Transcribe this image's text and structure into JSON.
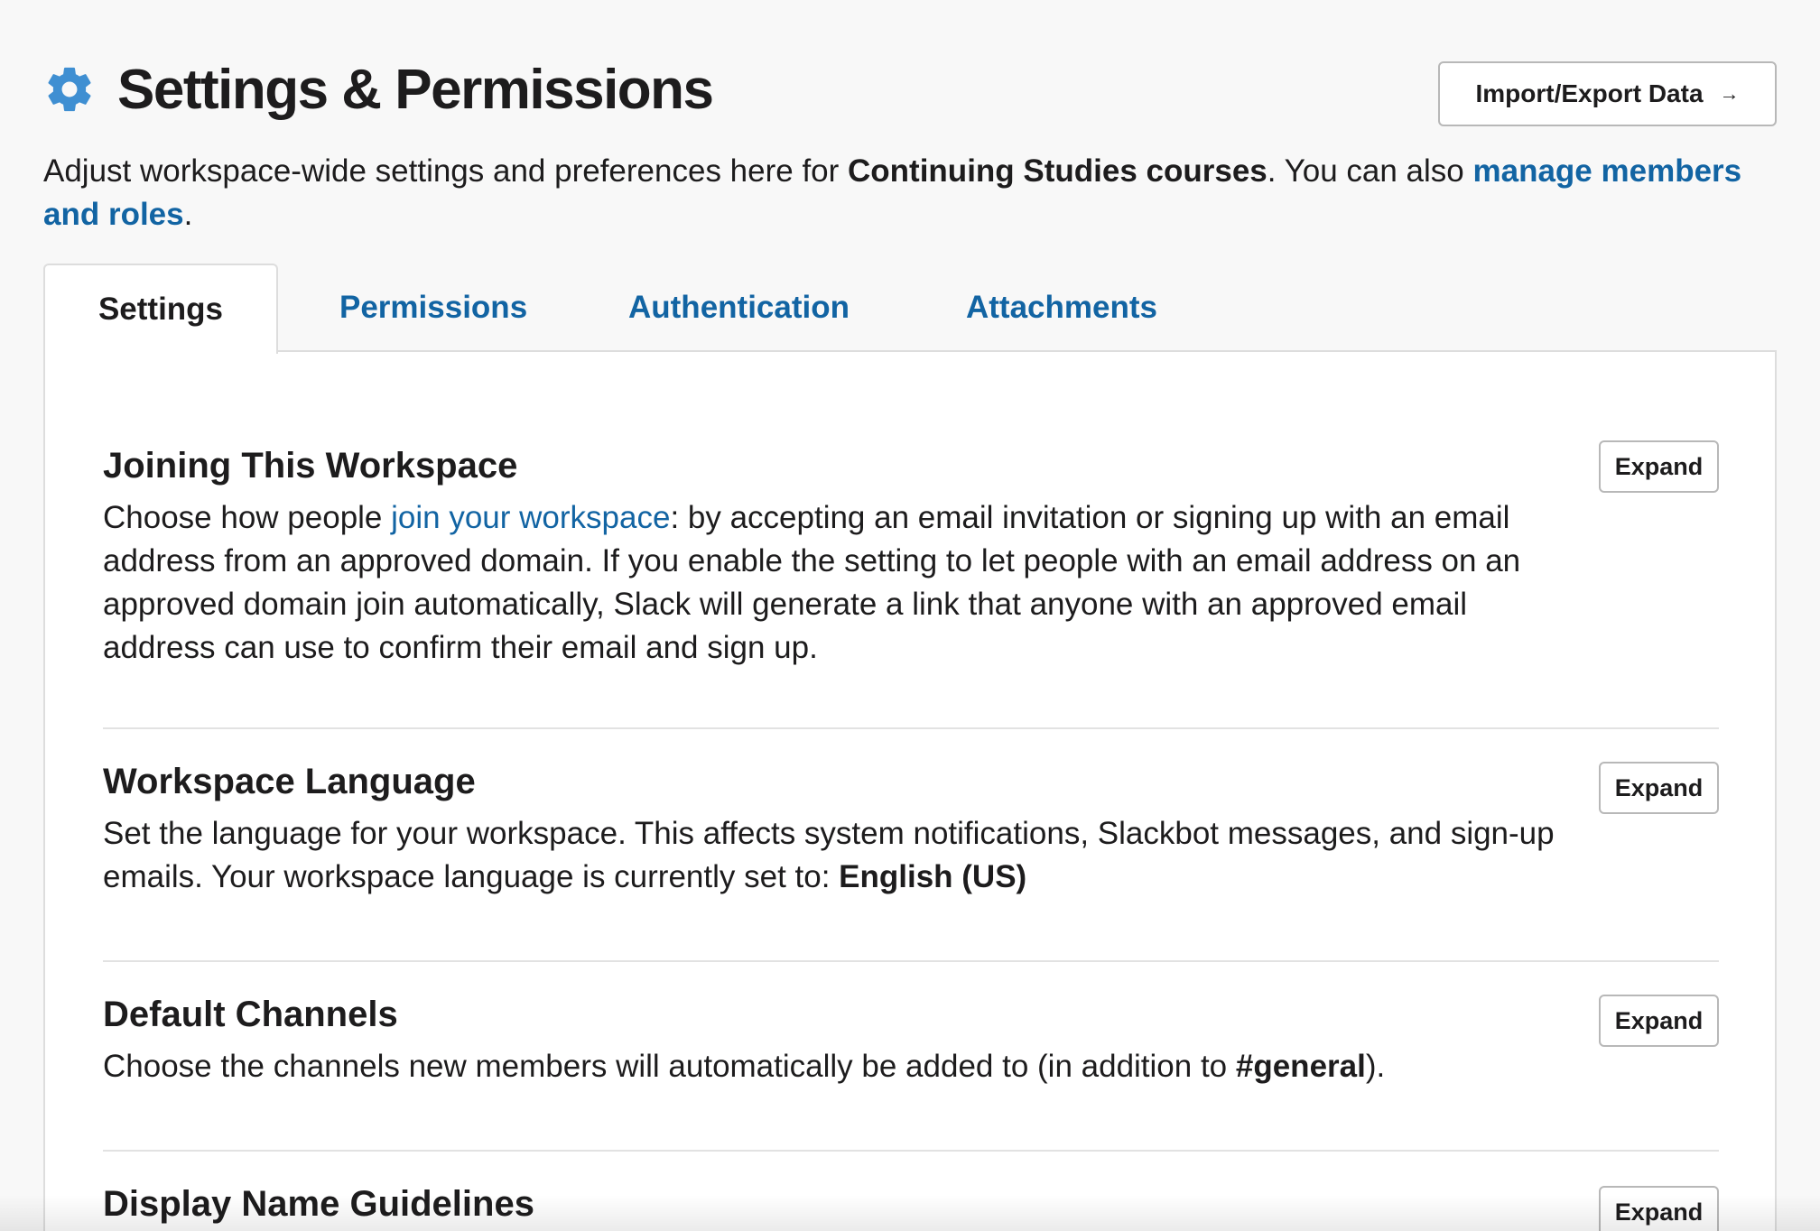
{
  "header": {
    "title": "Settings & Permissions",
    "icon": "gear-icon",
    "import_export_label": "Import/Export Data",
    "import_export_arrow": "→"
  },
  "intro": {
    "text_before": "Adjust workspace-wide settings and preferences here for ",
    "workspace_name": "Continuing Studies courses",
    "text_middle": ". You can also ",
    "link_text": "manage members and roles",
    "text_after": "."
  },
  "tabs": [
    {
      "label": "Settings",
      "active": true
    },
    {
      "label": "Permissions",
      "active": false
    },
    {
      "label": "Authentication",
      "active": false
    },
    {
      "label": "Attachments",
      "active": false
    }
  ],
  "sections": [
    {
      "title": "Joining This Workspace",
      "text_before": "Choose how people ",
      "link_text": "join your workspace",
      "text_after": ": by accepting an email invitation or signing up with an email address from an approved domain. If you enable the setting to let people with an email address on an approved domain join automatically, Slack will generate a link that anyone with an approved email address can use to confirm their email and sign up.",
      "button_label": "Expand"
    },
    {
      "title": "Workspace Language",
      "text_before": "Set the language for your workspace. This affects system notifications, Slackbot messages, and sign-up emails. Your workspace language is currently set to: ",
      "bold_text": "English (US)",
      "button_label": "Expand"
    },
    {
      "title": "Default Channels",
      "text_before": "Choose the channels new members will automatically be added to (in addition to ",
      "bold_text": "#general",
      "text_after": ").",
      "button_label": "Expand"
    },
    {
      "title": "Display Name Guidelines",
      "button_label": "Expand"
    }
  ],
  "colors": {
    "link": "#1264a3",
    "gear_icon": "#3f8fd2",
    "text": "#1d1c1d",
    "background": "#f8f8f8"
  }
}
